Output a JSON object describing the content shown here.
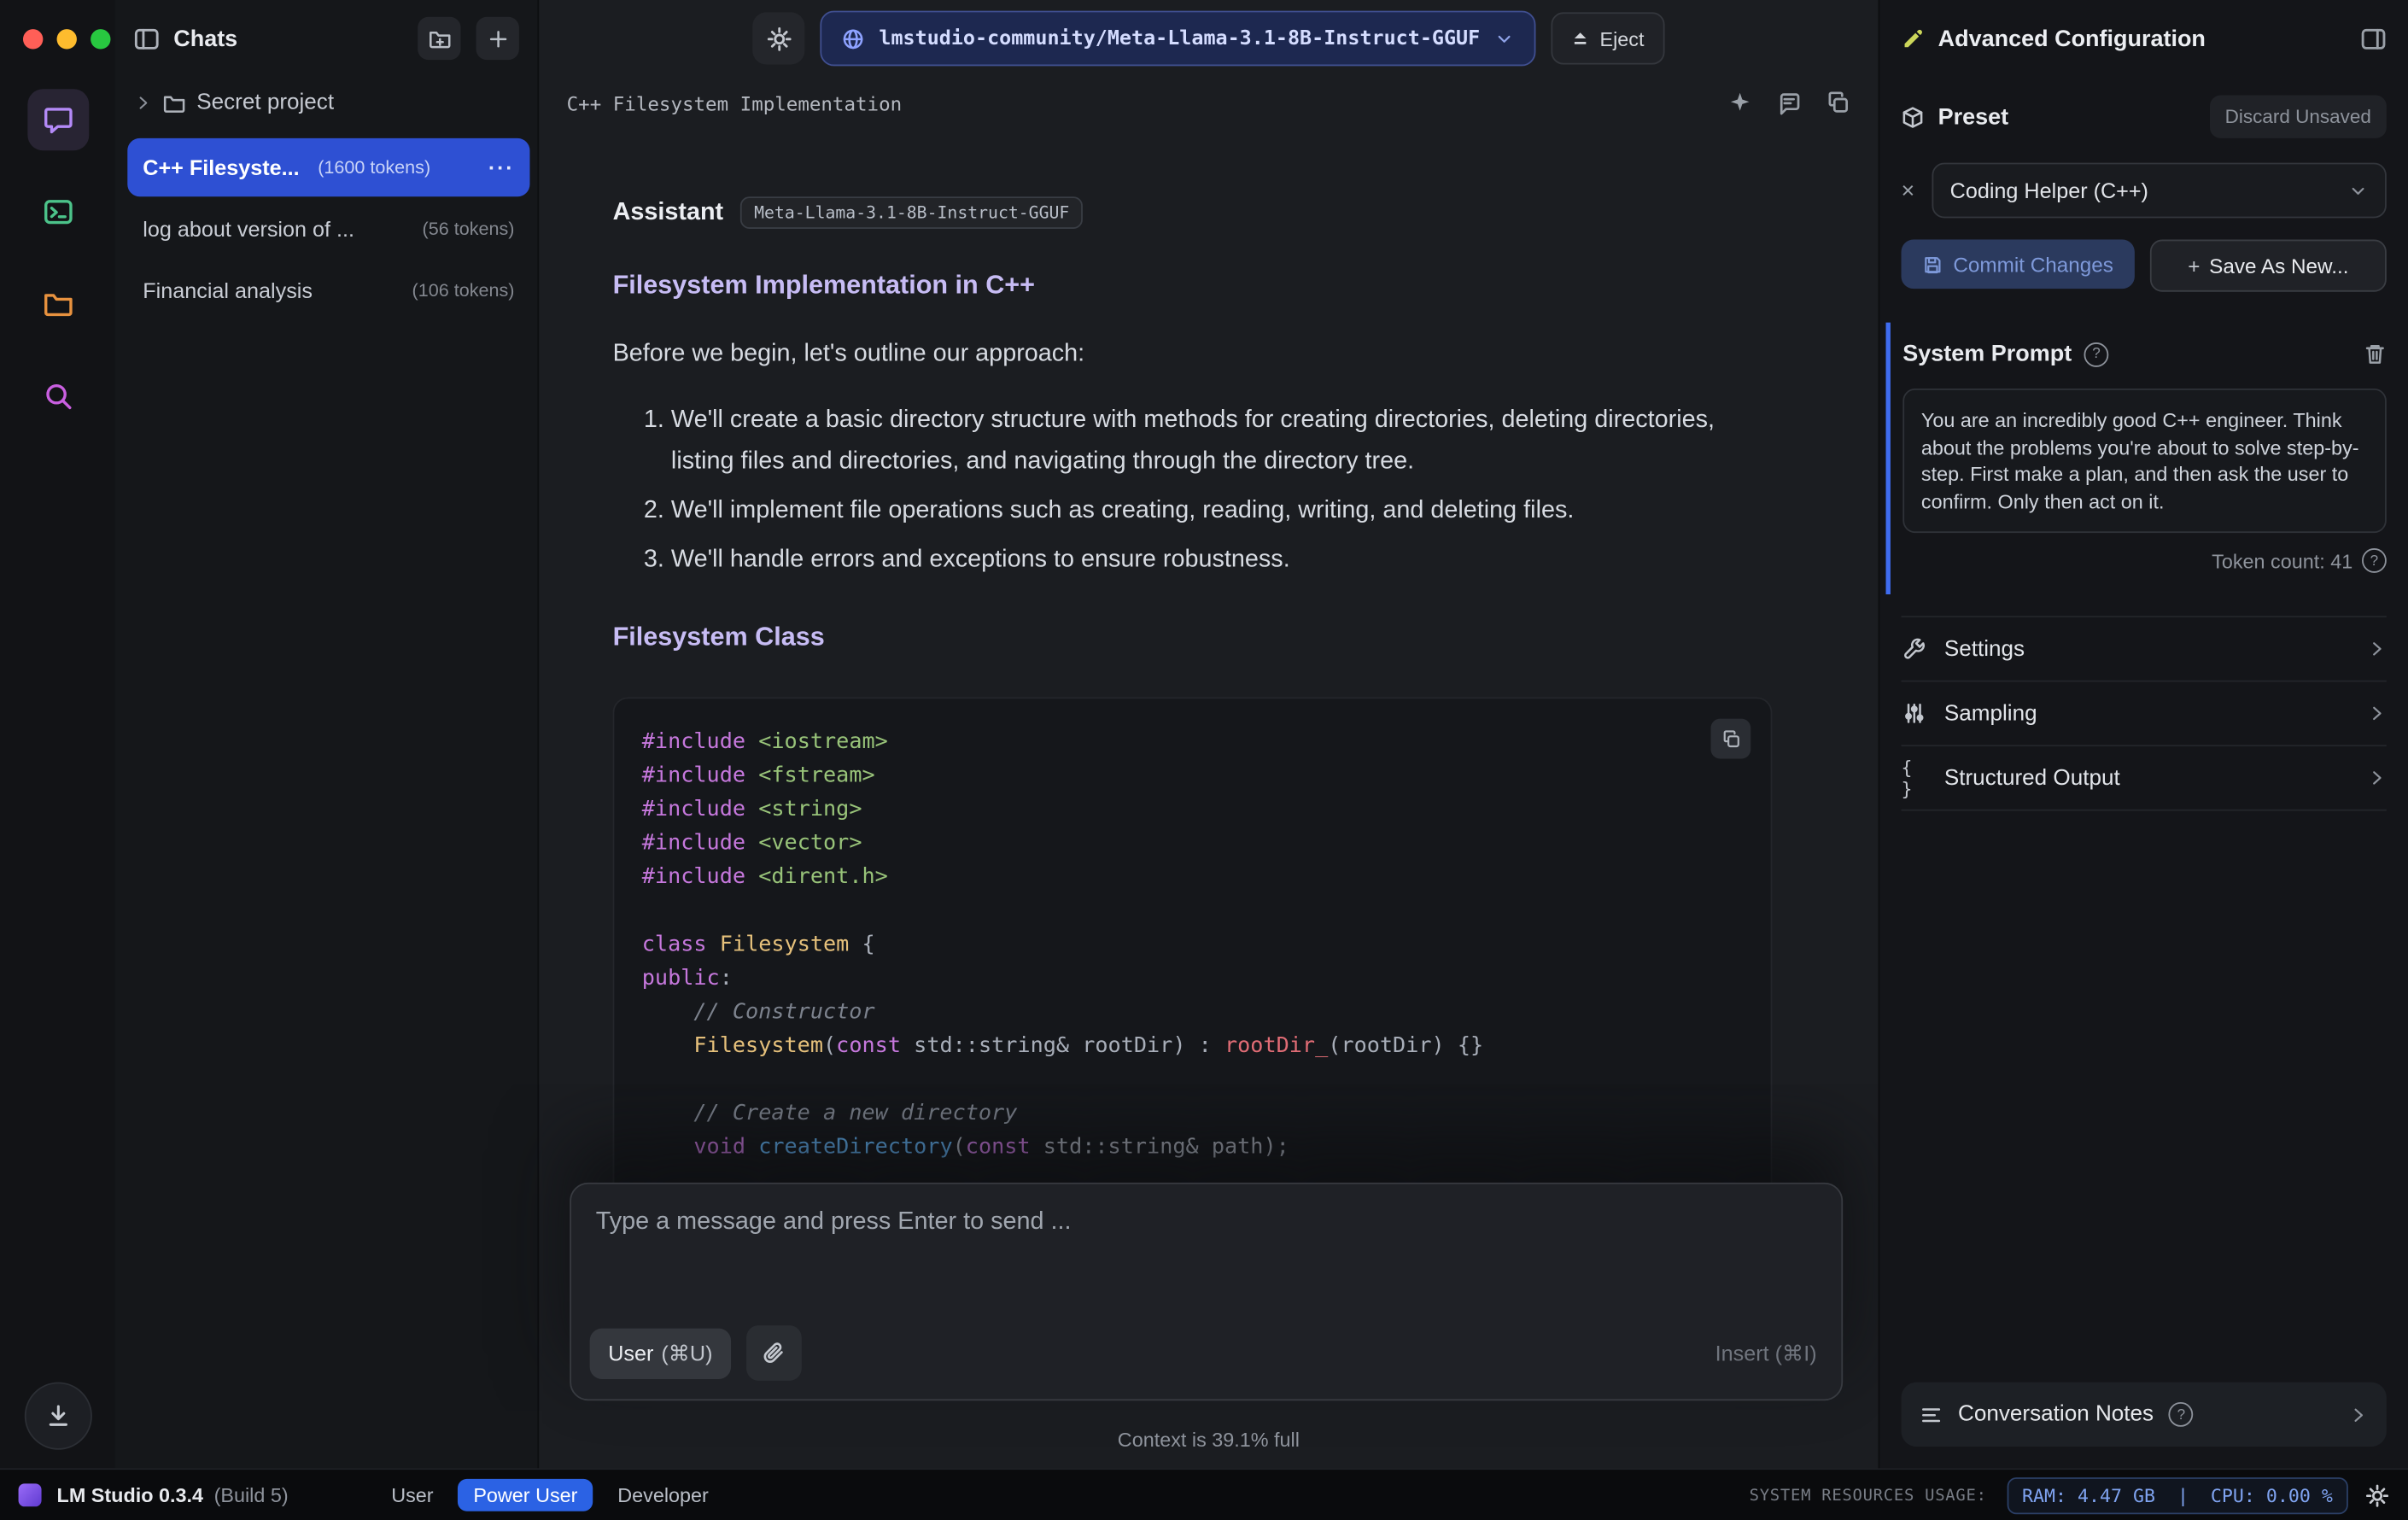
{
  "icons": {
    "ellipsis": "···",
    "chevron_right": "›",
    "question": "?",
    "close": "×",
    "plus": "+",
    "braces": "{ }"
  },
  "sidebar": {
    "title": "Chats",
    "folder_name": "Secret project",
    "chats": [
      {
        "name": "C++ Filesyste...",
        "tokens": "(1600 tokens)"
      },
      {
        "name": "log about version of ...",
        "tokens": "(56 tokens)"
      },
      {
        "name": "Financial analysis",
        "tokens": "(106 tokens)"
      }
    ]
  },
  "header": {
    "model": "lmstudio-community/Meta-Llama-3.1-8B-Instruct-GGUF",
    "eject_label": "Eject"
  },
  "chat": {
    "title": "C++ Filesystem Implementation",
    "assistant_label": "Assistant",
    "assistant_model_badge": "Meta-Llama-3.1-8B-Instruct-GGUF",
    "heading_main": "Filesystem Implementation in C++",
    "intro": "Before we begin, let's outline our approach:",
    "list": [
      "We'll create a basic directory structure with methods for creating directories, deleting directories, listing files and directories, and navigating through the directory tree.",
      "We'll implement file operations such as creating, reading, writing, and deleting files.",
      "We'll handle errors and exceptions to ensure robustness."
    ],
    "heading_class": "Filesystem Class",
    "code_lines": [
      [
        [
          "pp",
          "#include"
        ],
        [
          "pl",
          " "
        ],
        [
          "str",
          "<iostream>"
        ]
      ],
      [
        [
          "pp",
          "#include"
        ],
        [
          "pl",
          " "
        ],
        [
          "str",
          "<fstream>"
        ]
      ],
      [
        [
          "pp",
          "#include"
        ],
        [
          "pl",
          " "
        ],
        [
          "str",
          "<string>"
        ]
      ],
      [
        [
          "pp",
          "#include"
        ],
        [
          "pl",
          " "
        ],
        [
          "str",
          "<vector>"
        ]
      ],
      [
        [
          "pp",
          "#include"
        ],
        [
          "pl",
          " "
        ],
        [
          "str",
          "<dirent.h>"
        ]
      ],
      [],
      [
        [
          "kw",
          "class"
        ],
        [
          "pl",
          " "
        ],
        [
          "type",
          "Filesystem"
        ],
        [
          "pl",
          " {"
        ]
      ],
      [
        [
          "kw",
          "public"
        ],
        [
          "pl",
          ":"
        ]
      ],
      [
        [
          "pl",
          "    "
        ],
        [
          "cm",
          "// Constructor"
        ]
      ],
      [
        [
          "pl",
          "    "
        ],
        [
          "type",
          "Filesystem"
        ],
        [
          "pl",
          "("
        ],
        [
          "kw",
          "const"
        ],
        [
          "pl",
          " std::string& rootDir) : "
        ],
        [
          "var",
          "rootDir_"
        ],
        [
          "pl",
          "(rootDir) {}"
        ]
      ],
      [],
      [
        [
          "pl",
          "    "
        ],
        [
          "cm",
          "// Create a new directory"
        ]
      ],
      [
        [
          "pl",
          "    "
        ],
        [
          "kw",
          "void"
        ],
        [
          "pl",
          " "
        ],
        [
          "fn",
          "createDirectory"
        ],
        [
          "pl",
          "("
        ],
        [
          "kw",
          "const"
        ],
        [
          "pl",
          " std::string& path);"
        ]
      ]
    ],
    "input_placeholder": "Type a message and press Enter to send ...",
    "user_label": "User",
    "user_shortcut": "(⌘U)",
    "insert_label": "Insert (⌘I)",
    "context_status": "Context is 39.1% full"
  },
  "panel": {
    "title": "Advanced Configuration",
    "preset": {
      "label": "Preset",
      "discard_label": "Discard Unsaved",
      "value": "Coding Helper (C++)",
      "commit_label": "Commit Changes",
      "save_as_label": "Save As New..."
    },
    "system_prompt": {
      "label": "System Prompt",
      "text": "You are an incredibly good C++ engineer. Think about the problems you're about to solve step-by-step. First make a plan, and then ask the user to confirm. Only then act on it.",
      "token_count": "Token count: 41"
    },
    "sections": [
      "Settings",
      "Sampling",
      "Structured Output"
    ],
    "notes_label": "Conversation Notes"
  },
  "statusbar": {
    "app": "LM Studio 0.3.4",
    "build": "(Build 5)",
    "modes": [
      "User",
      "Power User",
      "Developer"
    ],
    "resources_label": "SYSTEM RESOURCES USAGE:",
    "resources_value": "RAM: 4.47 GB  |  CPU: 0.00 %"
  },
  "colors": {
    "accent_blue": "#2e50d3",
    "mode_active_blue": "#2b62e4",
    "heading_lavender": "#c7bcf4",
    "system_prompt_accent": "#3f6cf0",
    "pencil_lime": "#ccd65a"
  }
}
